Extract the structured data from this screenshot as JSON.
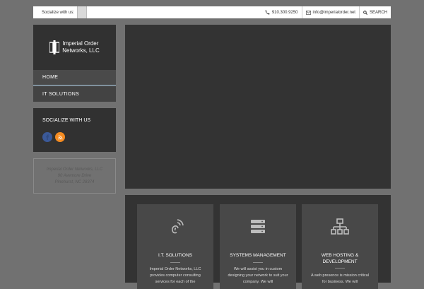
{
  "topbar": {
    "social_label": "Socialize with us:",
    "phone": "910.300.9250",
    "email": "info@imperialorder.net",
    "search_label": "SEARCH"
  },
  "logo": {
    "line1": "Imperial Order",
    "line2": "Networks, LLC"
  },
  "nav": {
    "items": [
      {
        "label": "HOME"
      },
      {
        "label": "IT SOLUTIONS"
      }
    ]
  },
  "social_widget": {
    "title": "SOCIALIZE WITH US",
    "icons": [
      "facebook-icon",
      "rss-icon"
    ]
  },
  "address": {
    "line1": "Imperial Order Networks, LLC",
    "line2": "90 Avemore Drive",
    "line3": "Pinehurst, NC 28374"
  },
  "services": [
    {
      "icon": "wireless-fingerprint-icon",
      "title": "I.T. SOLUTIONS",
      "desc": "Imperial Order Networks, LLC provides computer consulting services for each of the"
    },
    {
      "icon": "server-rack-icon",
      "title": "SYSTEMS MANAGEMENT",
      "desc": "We will assist you in custom designing your network to suit your company. We will"
    },
    {
      "icon": "network-icon",
      "title": "WEB HOSTING & DEVELOPMENT",
      "desc": "A web presence is mission critical for business. We will"
    }
  ],
  "colors": {
    "panel": "#313131",
    "accent": "#8fb0c9",
    "facebook": "#3b5998",
    "rss": "#f48b21"
  }
}
